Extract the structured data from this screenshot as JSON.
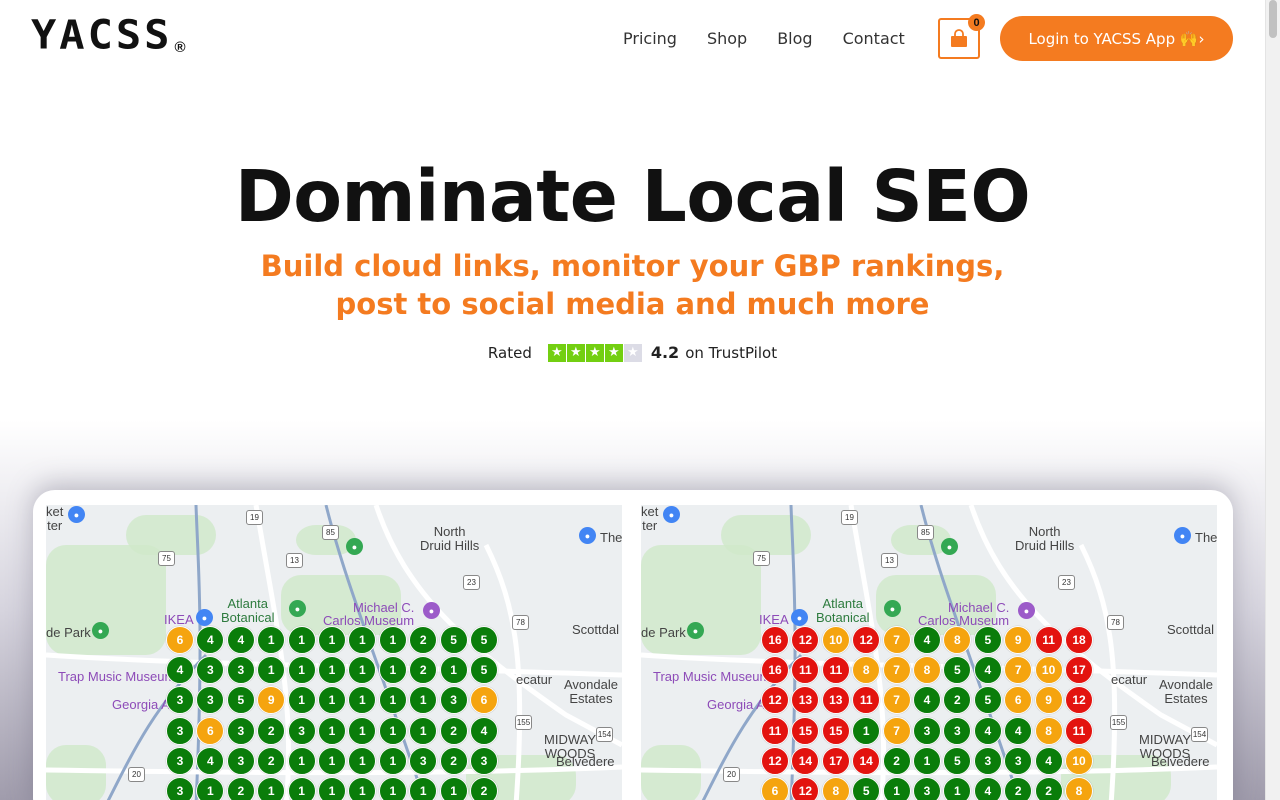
{
  "logo": {
    "text": "YACSS",
    "reg": "®"
  },
  "nav": [
    {
      "name": "nav-pricing",
      "label": "Pricing"
    },
    {
      "name": "nav-shop",
      "label": "Shop"
    },
    {
      "name": "nav-blog",
      "label": "Blog"
    },
    {
      "name": "nav-contact",
      "label": "Contact"
    }
  ],
  "cart": {
    "count": "0",
    "icon": "shopping-bag-icon"
  },
  "login_button": "Login to YACSS App 🙌›",
  "hero": {
    "title": "Dominate Local SEO",
    "subtitle_line1": "Build cloud links, monitor your GBP rankings,",
    "subtitle_line2": "post to social media and much more"
  },
  "rating": {
    "prefix": "Rated",
    "stars_filled": 4,
    "stars_total": 5,
    "score": "4.2",
    "suffix": "on TrustPilot"
  },
  "colors": {
    "accent": "#f47b20",
    "green": "#0a7d0a",
    "orange": "#f5a40f",
    "red": "#e3130f",
    "trustpilot": "#73cf11"
  },
  "map_labels": {
    "north_druid_hills": "North\nDruid Hills",
    "atlanta_botanical": "Atlanta\nBotanical",
    "michael_c": "Michael C.",
    "carlos_museum": "Carlos Museum",
    "ikea": "IKEA",
    "scottdale": "Scottdal",
    "ide_park": "de Park",
    "trap_music": "Trap Music Museum",
    "avondale": "Avondale\nEstates",
    "georgia": "Georgia A",
    "midway": "MIDWAY\nWOODS",
    "belvedere": "Belvedere",
    "ecatur": "ecatur",
    "ket": "ket\nter",
    "the": "The",
    "hw19": "19",
    "hw85": "85",
    "hw75": "75",
    "hw13": "13",
    "hw23": "23",
    "hw78": "78",
    "hw155": "155",
    "hw154": "154",
    "hw20": "20"
  },
  "grids": {
    "left": [
      [
        "6",
        "4",
        "4",
        "1",
        "1",
        "1",
        "1",
        "1",
        "2",
        "5",
        "5"
      ],
      [
        "4",
        "3",
        "3",
        "1",
        "1",
        "1",
        "1",
        "1",
        "2",
        "1",
        "5"
      ],
      [
        "3",
        "3",
        "5",
        "9",
        "1",
        "1",
        "1",
        "1",
        "1",
        "3",
        "6"
      ],
      [
        "3",
        "6",
        "3",
        "2",
        "3",
        "1",
        "1",
        "1",
        "1",
        "2",
        "4"
      ],
      [
        "3",
        "4",
        "3",
        "2",
        "1",
        "1",
        "1",
        "1",
        "3",
        "2",
        "3"
      ],
      [
        "3",
        "1",
        "2",
        "1",
        "1",
        "1",
        "1",
        "1",
        "1",
        "1",
        "2"
      ]
    ],
    "right": [
      [
        "16",
        "12",
        "10",
        "12",
        "7",
        "4",
        "8",
        "5",
        "9",
        "11",
        "18"
      ],
      [
        "16",
        "11",
        "11",
        "8",
        "7",
        "8",
        "5",
        "4",
        "7",
        "10",
        "17"
      ],
      [
        "12",
        "13",
        "13",
        "11",
        "7",
        "4",
        "2",
        "5",
        "6",
        "9",
        "12"
      ],
      [
        "11",
        "15",
        "15",
        "1",
        "7",
        "3",
        "3",
        "4",
        "4",
        "8",
        "11"
      ],
      [
        "12",
        "14",
        "17",
        "14",
        "2",
        "1",
        "5",
        "3",
        "3",
        "4",
        "10"
      ],
      [
        "6",
        "12",
        "8",
        "5",
        "1",
        "3",
        "1",
        "4",
        "2",
        "2",
        "8"
      ]
    ]
  }
}
